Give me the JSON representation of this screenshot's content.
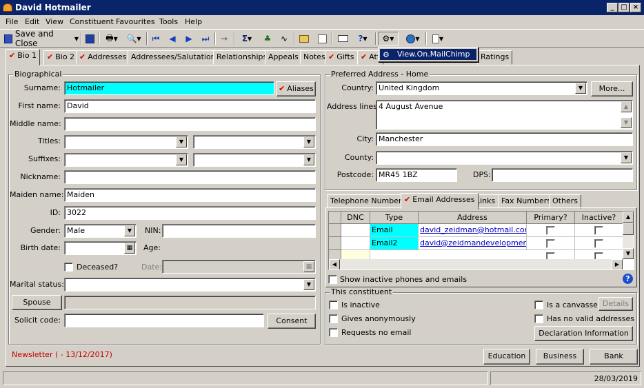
{
  "window": {
    "title": "David Hotmailer"
  },
  "menu": [
    "File",
    "Edit",
    "View",
    "Constituent",
    "Favourites",
    "Tools",
    "Help"
  ],
  "toolbar": {
    "save_close": "Save and Close",
    "popup_item": "View.On.MailChimp"
  },
  "tabs": [
    "Bio 1",
    "Bio 2",
    "Addresses",
    "Addressees/Salutations",
    "Relationships",
    "Appeals",
    "Notes",
    "Gifts",
    "Att",
    "Ratings"
  ],
  "bio": {
    "legend": "Biographical",
    "surname_label": "Surname:",
    "surname": "Hotmailer",
    "aliases": "Aliases",
    "first_label": "First name:",
    "first": "David",
    "middle_label": "Middle name:",
    "titles_label": "Titles:",
    "suffixes_label": "Suffixes:",
    "nickname_label": "Nickname:",
    "maiden_label": "Maiden name:",
    "maiden": "Maiden",
    "id_label": "ID:",
    "id": "3022",
    "gender_label": "Gender:",
    "gender": "Male",
    "nin_label": "NIN:",
    "birth_label": "Birth date:",
    "age_label": "Age:",
    "deceased_label": "Deceased?",
    "date_label": "Date:",
    "marital_label": "Marital status:",
    "spouse": "Spouse",
    "solicit_label": "Solicit code:",
    "consent": "Consent"
  },
  "address": {
    "legend": "Preferred Address - Home",
    "country_label": "Country:",
    "country": "United Kingdom",
    "more": "More...",
    "lines_label": "Address lines:",
    "lines": "4 August Avenue",
    "city_label": "City:",
    "city": "Manchester",
    "county_label": "County:",
    "postcode_label": "Postcode:",
    "postcode": "MR45 1BZ",
    "dps_label": "DPS:"
  },
  "subtabs": [
    "Telephone Numbers",
    "Email Addresses",
    "Links",
    "Fax Numbers",
    "Others"
  ],
  "email_grid": {
    "headers": [
      "DNC",
      "Type",
      "Address",
      "Primary?",
      "Inactive?"
    ],
    "rows": [
      {
        "type": "Email",
        "address": "david_zeidman@hotmail.com"
      },
      {
        "type": "Email2",
        "address": "david@zeidmandevelopment...."
      }
    ],
    "show_inactive": "Show inactive phones and emails"
  },
  "constituent": {
    "legend": "This constituent",
    "is_inactive": "Is inactive",
    "anonymous": "Gives anonymously",
    "no_email": "Requests no email",
    "canvasser": "Is a canvasser",
    "details": "Details",
    "no_valid": "Has no valid addresses",
    "declaration": "Declaration Information"
  },
  "footer": {
    "newsletter": "Newsletter ( - 13/12/2017)",
    "education": "Education",
    "business": "Business",
    "bank": "Bank"
  },
  "status": {
    "date": "28/03/2019"
  }
}
